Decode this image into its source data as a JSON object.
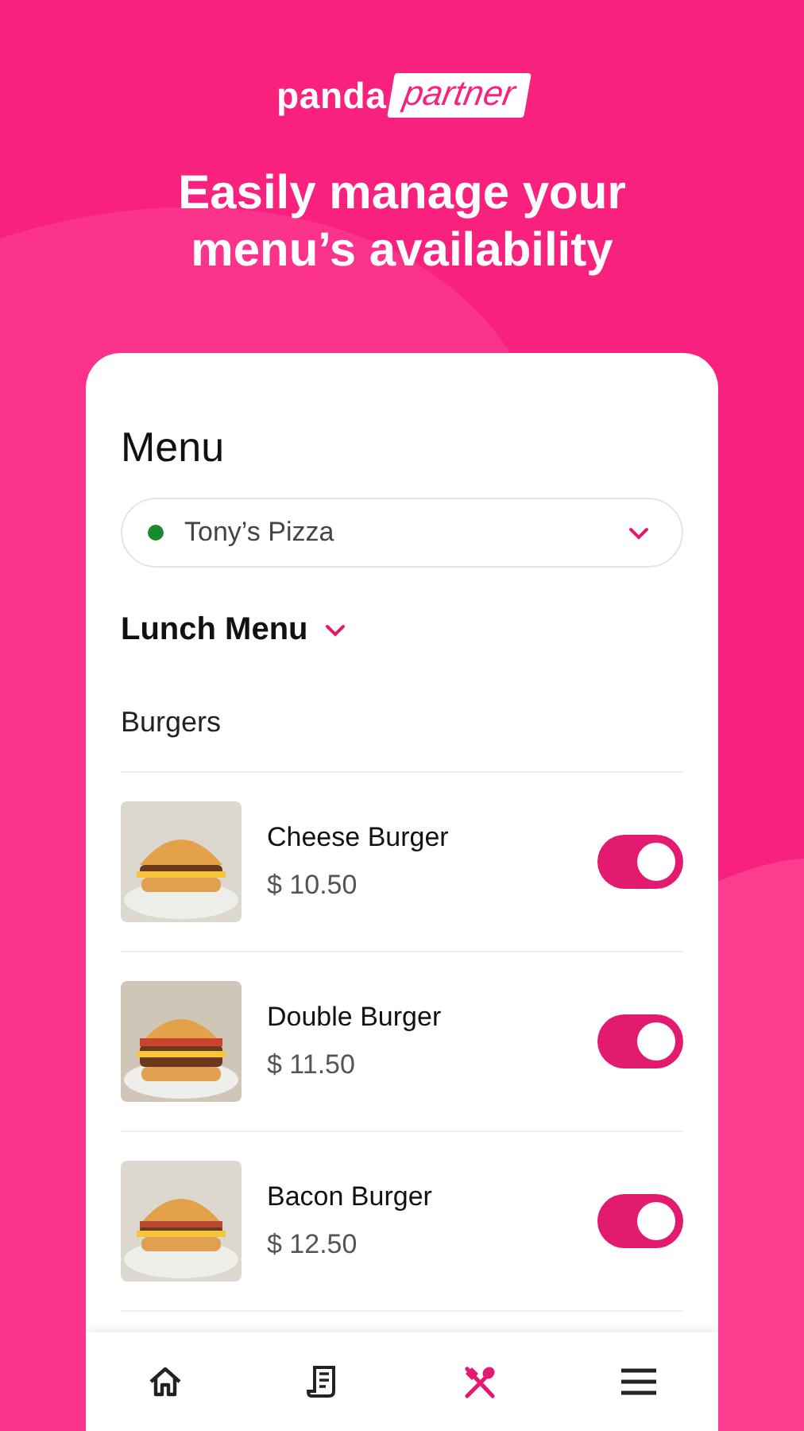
{
  "brand": {
    "name": "panda",
    "tag": "partner"
  },
  "headline": "Easily manage your menu’s availability",
  "screen": {
    "title": "Menu",
    "restaurant": {
      "name": "Tony’s Pizza",
      "open": true
    },
    "menu_name": "Lunch Menu",
    "category": "Burgers",
    "items": [
      {
        "name": "Cheese Burger",
        "price": "$ 10.50",
        "kind": "picture",
        "on": true
      },
      {
        "name": "Double Burger",
        "price": "$ 11.50",
        "kind": "picture",
        "on": true
      },
      {
        "name": "Bacon Burger",
        "price": "$ 12.50",
        "kind": "picture",
        "on": true
      }
    ],
    "nav": [
      {
        "kind": "home",
        "selected": false
      },
      {
        "kind": "orders",
        "selected": false
      },
      {
        "kind": "menu",
        "selected": true
      },
      {
        "kind": "more",
        "selected": false
      }
    ]
  }
}
